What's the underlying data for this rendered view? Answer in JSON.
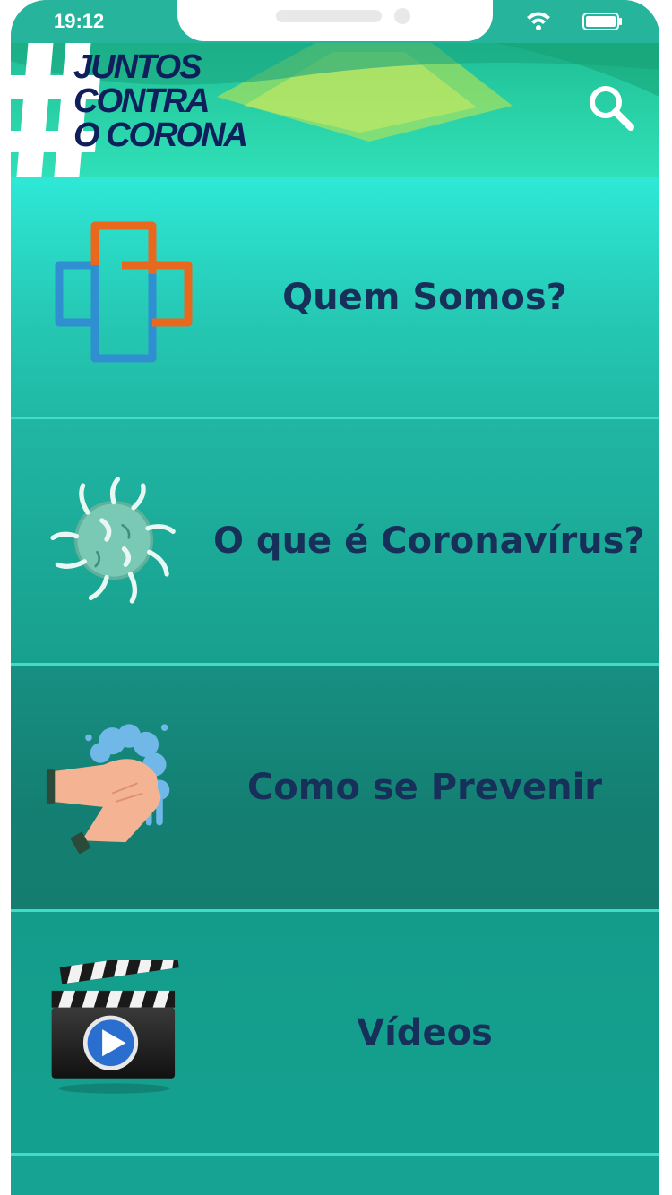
{
  "status_bar": {
    "time": "19:12",
    "wifi_icon": "wifi-icon",
    "battery_icon": "battery-icon"
  },
  "header": {
    "logo_lines": [
      "JUNTOS",
      "CONTRA",
      "O CORONA"
    ],
    "logo_symbol": "#",
    "search_icon": "search-icon"
  },
  "menu": {
    "items": [
      {
        "label": "Quem Somos?",
        "icon": "medical-cross-icon"
      },
      {
        "label": "O que é Coronavírus?",
        "icon": "virus-icon"
      },
      {
        "label": "Como se Prevenir",
        "icon": "hand-washing-icon"
      },
      {
        "label": "Vídeos",
        "icon": "clapperboard-play-icon"
      }
    ]
  },
  "colors": {
    "label_text": "#17305a",
    "accent_orange": "#e8681e",
    "accent_blue": "#2f8fd0"
  }
}
